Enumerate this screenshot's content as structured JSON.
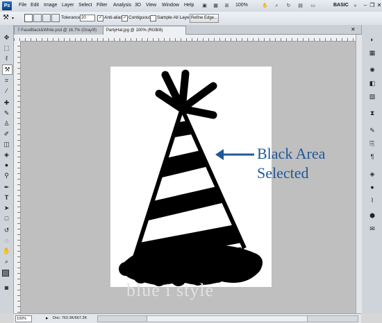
{
  "app": {
    "logo": "Ps"
  },
  "menu": [
    "File",
    "Edit",
    "Image",
    "Layer",
    "Select",
    "Filter",
    "Analysis",
    "3D",
    "View",
    "Window",
    "Help"
  ],
  "menubar_right": {
    "zoom": "100%",
    "workspace": "BASIC"
  },
  "options_bar": {
    "tolerance_label": "Tolerance:",
    "tolerance_value": "20",
    "antialias_label": "Anti-alias",
    "contiguous_label": "Contiguous",
    "sample_all_label": "Sample All Layers",
    "refine_edge_label": "Refine Edge...",
    "antialias_checked": true,
    "contiguous_checked": true,
    "sample_all_checked": false
  },
  "tabs": [
    {
      "label": "7-FaceBlack&White.psd @ 16.7% (Gray/8)",
      "active": false
    },
    {
      "label": "PartyHat.jpg @ 100% (RGB/8)",
      "active": true
    }
  ],
  "annotation": {
    "line1": "Black Area",
    "line2": "Selected",
    "color": "#1f5899"
  },
  "watermark": "blue i style",
  "status": {
    "zoom": "100%",
    "doc": "Doc: 762.3K/667.2K"
  },
  "colors": {
    "canvas_bg": "#bfbfbf",
    "accent": "#1f5899"
  }
}
